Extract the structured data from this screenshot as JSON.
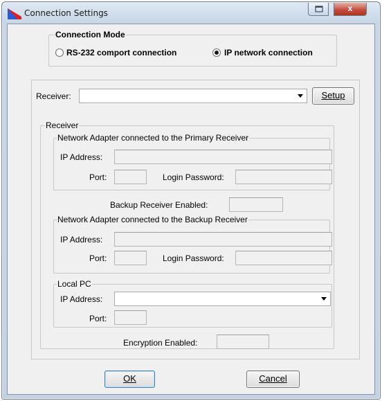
{
  "window": {
    "title": "Connection Settings",
    "close_glyph": "x"
  },
  "connection_mode": {
    "title": "Connection Mode",
    "options": [
      {
        "label": "RS-232 comport connection",
        "selected": false
      },
      {
        "label": "IP network connection",
        "selected": true
      }
    ]
  },
  "receiver_select": {
    "label": "Receiver:",
    "value": "",
    "setup_button_label": "Setup"
  },
  "receiver_group": {
    "title": "Receiver",
    "primary": {
      "title": "Network Adapter connected to the Primary Receiver",
      "ip_label": "IP Address:",
      "ip_value": "",
      "port_label": "Port:",
      "port_value": "",
      "password_label": "Login Password:",
      "password_value": ""
    },
    "backup_enabled_label": "Backup Receiver Enabled:",
    "backup_enabled_value": "",
    "backup": {
      "title": "Network Adapter connected to the Backup Receiver",
      "ip_label": "IP Address:",
      "ip_value": "",
      "port_label": "Port:",
      "port_value": "",
      "password_label": "Login Password:",
      "password_value": ""
    },
    "local_pc": {
      "title": "Local PC",
      "ip_label": "IP Address:",
      "ip_value": "",
      "port_label": "Port:",
      "port_value": ""
    },
    "encryption_label": "Encryption Enabled:",
    "encryption_value": ""
  },
  "buttons": {
    "ok": "OK",
    "cancel": "Cancel"
  },
  "icons": {
    "app": "app-flag-icon",
    "minimize": "restore-icon",
    "close": "close-icon",
    "dropdown": "dropdown-arrow-icon"
  },
  "colors": {
    "title_gradient_top": "#dfe8f3",
    "client_background": "#f0f0f0",
    "close_button": "#c2493a",
    "default_button_border": "#3c7fb1"
  }
}
